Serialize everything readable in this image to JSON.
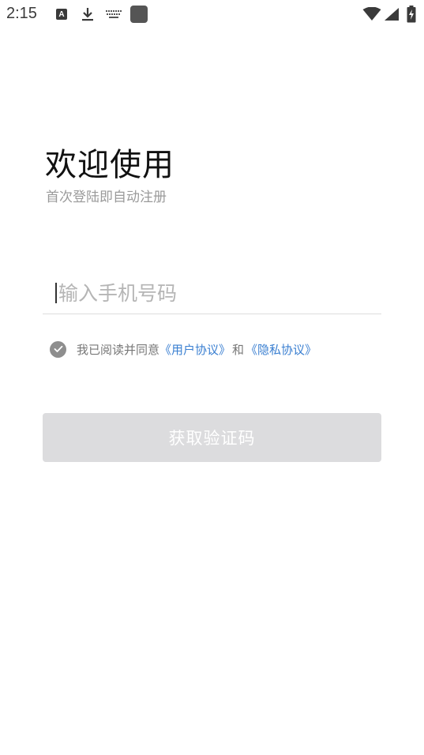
{
  "status_bar": {
    "time": "2:15",
    "a_icon_letter": "A",
    "icons": [
      "a-notification-icon",
      "download-icon",
      "keyboard-icon",
      "app-square-icon",
      "wifi-icon",
      "signal-icon",
      "battery-charging-icon"
    ]
  },
  "welcome": {
    "title": "欢迎使用",
    "subtitle": "首次登陆即自动注册"
  },
  "phone": {
    "placeholder": "输入手机号码",
    "value": ""
  },
  "agreement": {
    "checked": true,
    "prefix": "我已阅读并同意",
    "user_agreement": "《用户协议》",
    "and": "和",
    "privacy_policy": "《隐私协议》"
  },
  "button": {
    "label": "获取验证码",
    "enabled": false
  },
  "colors": {
    "link": "#3a7fd1",
    "button_disabled": "#dcdcde",
    "check_bg": "#8e8e8e"
  }
}
